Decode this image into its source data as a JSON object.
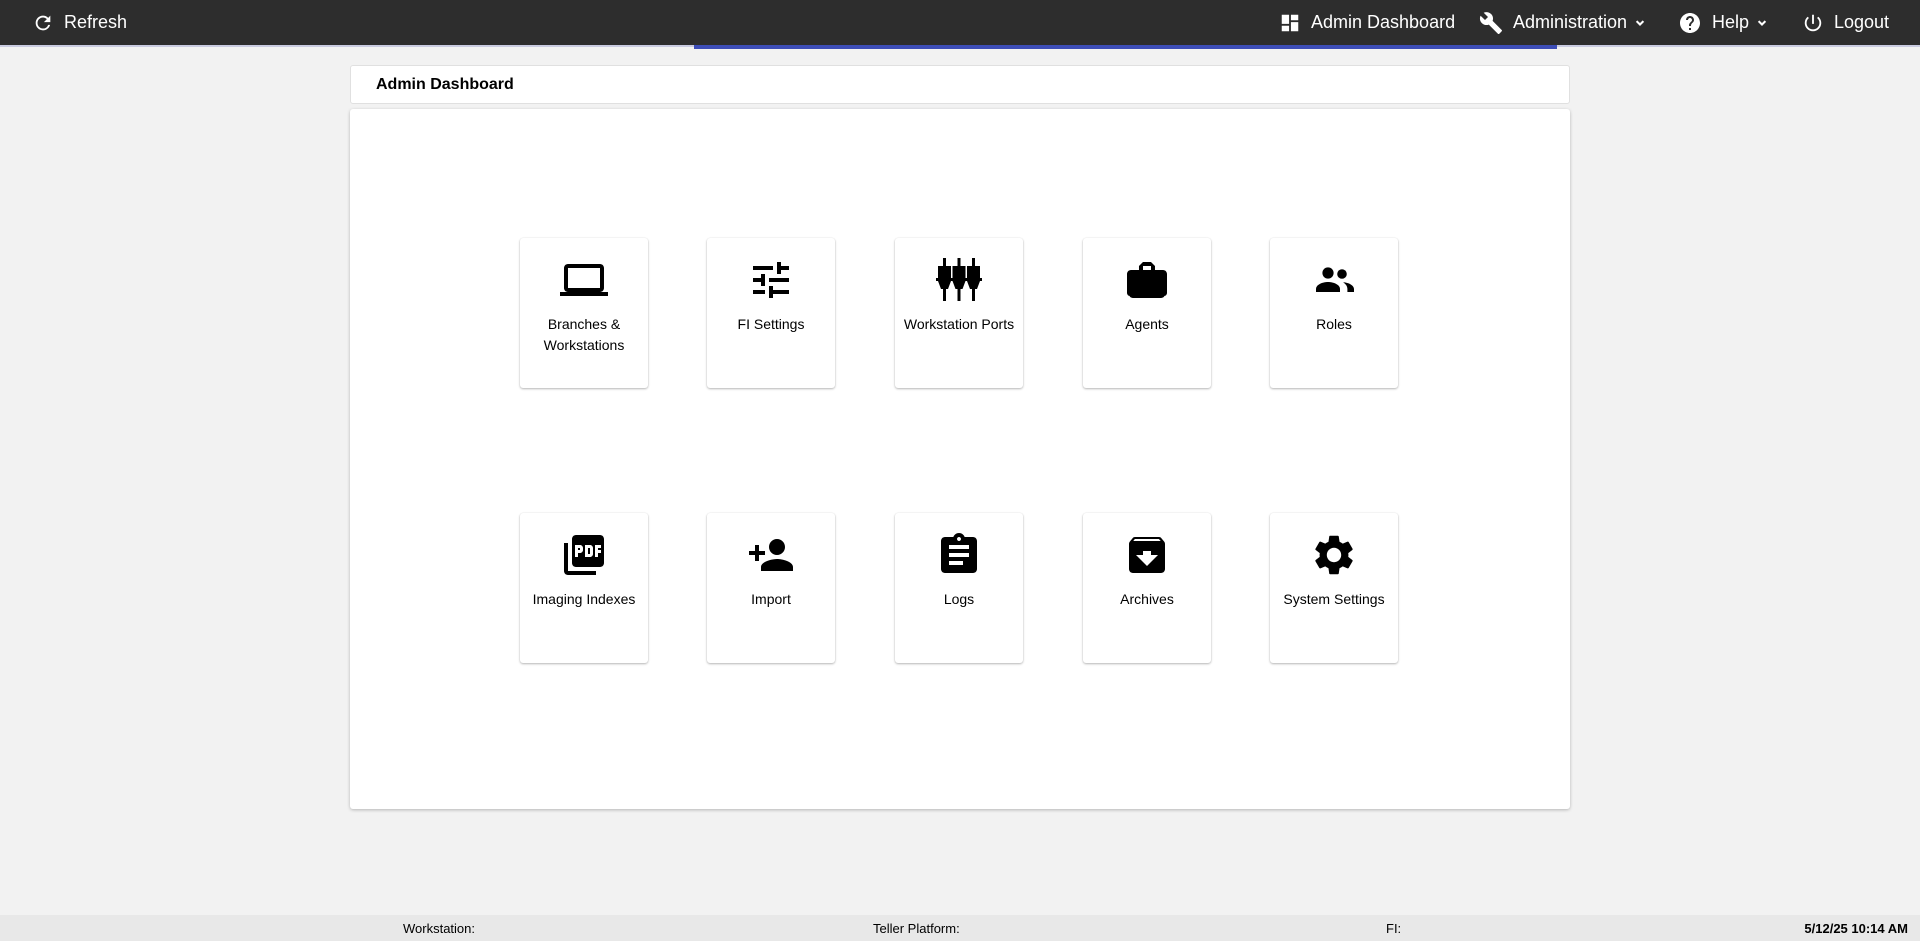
{
  "topbar": {
    "refresh_label": "Refresh",
    "admin_dashboard_label": "Admin Dashboard",
    "administration_label": "Administration",
    "help_label": "Help",
    "logout_label": "Logout"
  },
  "page": {
    "title": "Admin Dashboard"
  },
  "tiles": [
    {
      "label": "Branches & Workstations",
      "icon": "laptop-icon"
    },
    {
      "label": "FI Settings",
      "icon": "tune-icon"
    },
    {
      "label": "Workstation Ports",
      "icon": "ports-icon"
    },
    {
      "label": "Agents",
      "icon": "briefcase-icon"
    },
    {
      "label": "Roles",
      "icon": "people-icon"
    },
    {
      "label": "Imaging Indexes",
      "icon": "pdf-icon"
    },
    {
      "label": "Import",
      "icon": "person-add-icon"
    },
    {
      "label": "Logs",
      "icon": "clipboard-icon"
    },
    {
      "label": "Archives",
      "icon": "archive-icon"
    },
    {
      "label": "System Settings",
      "icon": "gear-icon"
    }
  ],
  "statusbar": {
    "workstation_label": "Workstation:",
    "teller_platform_label": "Teller Platform:",
    "fi_label": "FI:",
    "datetime": "5/12/25 10:14 AM"
  },
  "colors": {
    "topbar_bg": "#2d2d2d",
    "accent": "#3d4db7",
    "page_bg": "#f2f2f2"
  }
}
